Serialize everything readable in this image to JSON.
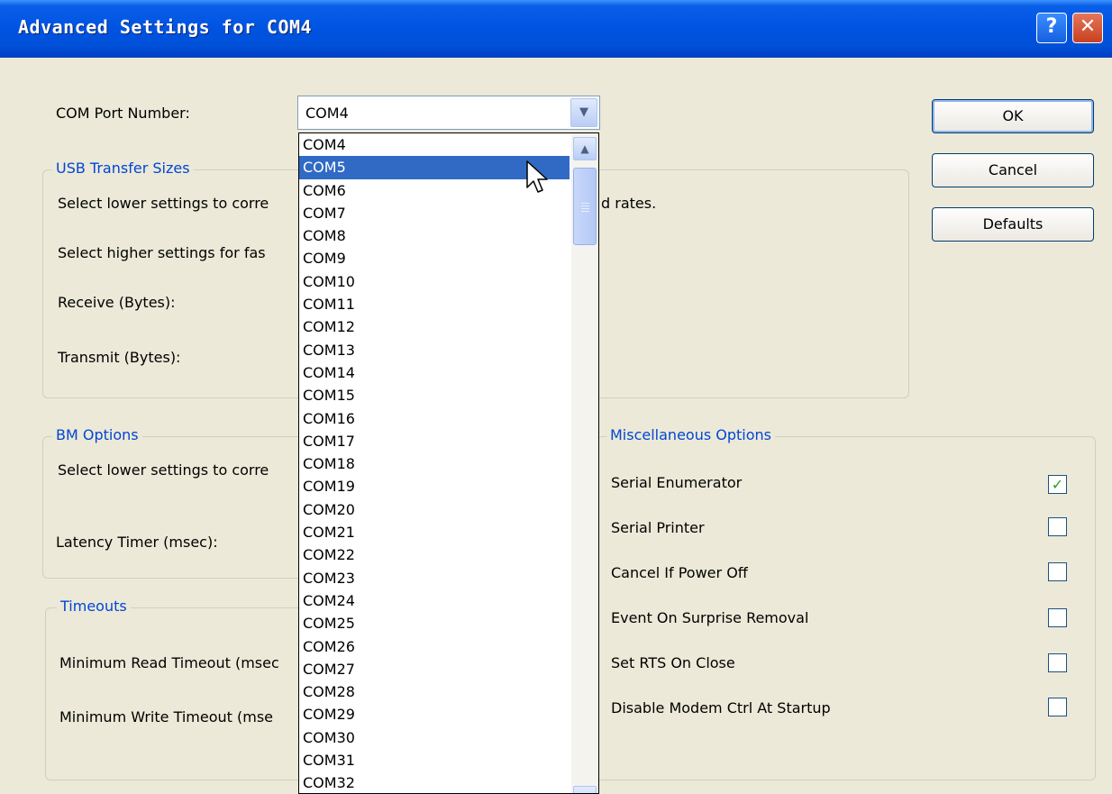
{
  "window": {
    "title": "Advanced Settings for COM4",
    "help_icon": "?",
    "close_icon": "✕"
  },
  "port": {
    "label": "COM Port Number:",
    "value": "COM4"
  },
  "buttons": {
    "ok": "OK",
    "cancel": "Cancel",
    "defaults": "Defaults"
  },
  "usb": {
    "title": "USB Transfer Sizes",
    "line1": "Select lower settings to corre",
    "line1_tail": "d rates.",
    "line2": "Select higher settings for fas",
    "receive": "Receive (Bytes):",
    "transmit": "Transmit (Bytes):"
  },
  "bm": {
    "title": "BM Options",
    "line1": "Select lower settings to corre",
    "latency": "Latency Timer (msec):"
  },
  "timeouts": {
    "title": "Timeouts",
    "read": "Minimum Read Timeout (msec",
    "write": "Minimum Write Timeout (mse"
  },
  "misc": {
    "title": "Miscellaneous Options",
    "options": [
      {
        "label": "Serial Enumerator",
        "checked": true
      },
      {
        "label": "Serial Printer",
        "checked": false
      },
      {
        "label": "Cancel If Power Off",
        "checked": false
      },
      {
        "label": "Event On Surprise Removal",
        "checked": false
      },
      {
        "label": "Set RTS On Close",
        "checked": false
      },
      {
        "label": "Disable Modem Ctrl At Startup",
        "checked": false
      }
    ]
  },
  "dropdown": {
    "selected": "COM5",
    "items": [
      "COM4",
      "COM5",
      "COM6",
      "COM7",
      "COM8",
      "COM9",
      "COM10",
      "COM11",
      "COM12",
      "COM13",
      "COM14",
      "COM15",
      "COM16",
      "COM17",
      "COM18",
      "COM19",
      "COM20",
      "COM21",
      "COM22",
      "COM23",
      "COM24",
      "COM25",
      "COM26",
      "COM27",
      "COM28",
      "COM29",
      "COM30",
      "COM31",
      "COM32"
    ]
  },
  "colors": {
    "titlebar": "#0054e3",
    "group_title": "#0046d5",
    "selection": "#316ac5",
    "background": "#ece9d8"
  }
}
